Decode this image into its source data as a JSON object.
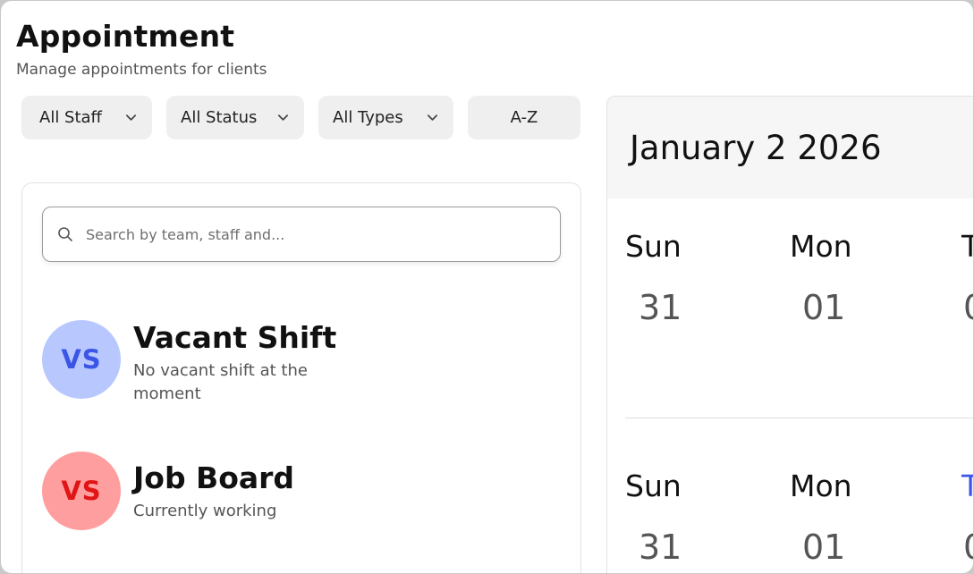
{
  "header": {
    "title": "Appointment",
    "subtitle": "Manage appointments for clients"
  },
  "filters": {
    "staff": "All Staff",
    "status": "All Status",
    "types": "All Types",
    "sort": "A-Z"
  },
  "search": {
    "placeholder": "Search by team, staff and..."
  },
  "entries": [
    {
      "initials": "VS",
      "title": "Vacant Shift",
      "description": "No vacant shift at the moment",
      "avatar_bg": "#b8c8ff",
      "avatar_fg": "#3b55e6"
    },
    {
      "initials": "VS",
      "title": "Job Board",
      "description": "Currently working",
      "avatar_bg": "#ff9e9e",
      "avatar_fg": "#e01515"
    }
  ],
  "calendar": {
    "title": "January 2 2026",
    "weeks": [
      {
        "days": [
          {
            "name": "Sun",
            "num": "31"
          },
          {
            "name": "Mon",
            "num": "01"
          },
          {
            "name": "T",
            "num": "0"
          }
        ]
      },
      {
        "days": [
          {
            "name": "Sun",
            "num": "31"
          },
          {
            "name": "Mon",
            "num": "01"
          },
          {
            "name": "T",
            "num": "0"
          }
        ]
      }
    ],
    "highlight_color": "#3b55e6"
  }
}
